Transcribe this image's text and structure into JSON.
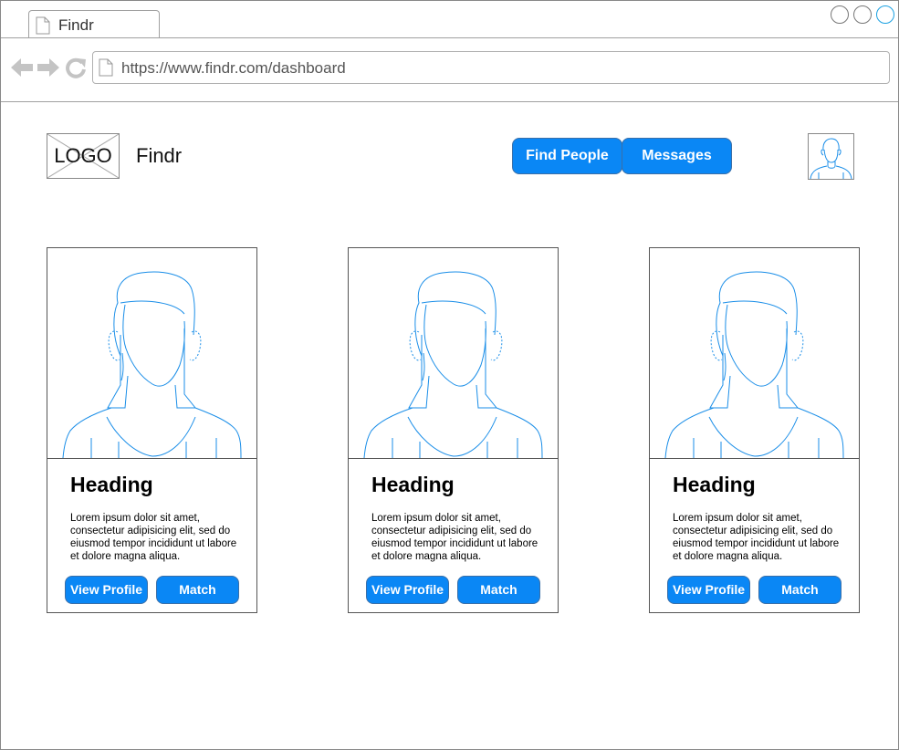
{
  "browser": {
    "tab_title": "Findr",
    "url": "https://www.findr.com/dashboard"
  },
  "header": {
    "logo_text": "LOGO",
    "brand": "Findr",
    "nav": [
      {
        "label": "Find People"
      },
      {
        "label": "Messages"
      }
    ]
  },
  "cards": [
    {
      "heading": "Heading",
      "body": "Lorem ipsum dolor sit amet, consectetur adipisicing elit, sed do eiusmod tempor incididunt ut labore et dolore magna aliqua.",
      "view_label": "View Profile",
      "match_label": "Match"
    },
    {
      "heading": "Heading",
      "body": "Lorem ipsum dolor sit amet, consectetur adipisicing elit, sed do eiusmod tempor incididunt ut labore et dolore magna aliqua.",
      "view_label": "View Profile",
      "match_label": "Match"
    },
    {
      "heading": "Heading",
      "body": "Lorem ipsum dolor sit amet, consectetur adipisicing elit, sed do eiusmod tempor incididunt ut labore et dolore magna aliqua.",
      "view_label": "View Profile",
      "match_label": "Match"
    }
  ],
  "colors": {
    "accent": "#0a87f5",
    "sketch_line": "#1a8ee8"
  },
  "icons": {
    "tab": "page-icon",
    "back": "back-arrow-icon",
    "forward": "forward-arrow-icon",
    "reload": "reload-icon",
    "address": "page-icon",
    "avatar": "user-avatar-icon",
    "profile_photo": "woman-portrait-icon"
  }
}
